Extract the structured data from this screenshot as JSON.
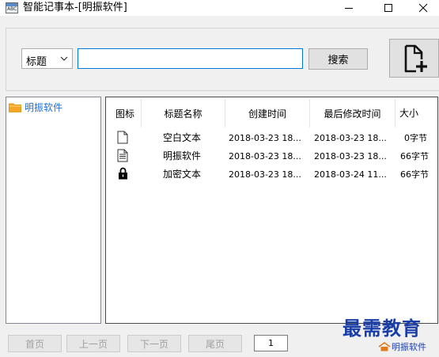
{
  "window": {
    "title": "智能记事本-[明振软件]"
  },
  "search": {
    "field_options_selected": "标题",
    "query": "",
    "button_label": "搜索"
  },
  "tree": {
    "items": [
      {
        "label": "明振软件",
        "icon": "folder-icon"
      }
    ]
  },
  "list": {
    "columns": [
      "图标",
      "标题名称",
      "创建时间",
      "最后修改时间",
      "大小"
    ],
    "rows": [
      {
        "icon": "blank-document-icon",
        "title": "空白文本",
        "created": "2018-03-23 18...",
        "modified": "2018-03-23 18...",
        "size": "0字节"
      },
      {
        "icon": "text-document-icon",
        "title": "明振软件",
        "created": "2018-03-23 18...",
        "modified": "2018-03-23 18...",
        "size": "66字节"
      },
      {
        "icon": "lock-icon",
        "title": "加密文本",
        "created": "2018-03-23 18...",
        "modified": "2018-03-24 11...",
        "size": "66字节"
      }
    ]
  },
  "pager": {
    "first": "首页",
    "prev": "上一页",
    "next": "下一页",
    "last": "尾页",
    "current_page": "1"
  },
  "watermark": {
    "title": "最需教育",
    "sub": "明振软件"
  },
  "colors": {
    "accent": "#0078d7",
    "tree_label": "#1e6fd9",
    "folder": "#f5a623",
    "watermark": "#1a3ea8"
  }
}
